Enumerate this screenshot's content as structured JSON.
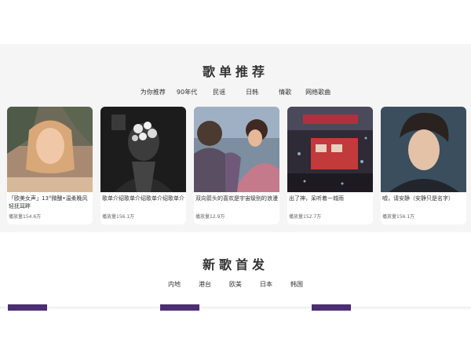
{
  "recommend": {
    "title": "歌单推荐",
    "tabs": [
      "为你推荐",
      "90年代",
      "民谣",
      "日韩",
      "情歌",
      "网络歌曲"
    ],
    "playlists": [
      {
        "title": "「欧美女声」13°微醺•温柔晚风轻抚耳畔",
        "plays": "播放量154.6万"
      },
      {
        "title": "歌单介绍歌单介绍歌单介绍歌单介",
        "plays": "播放量156.1万"
      },
      {
        "title": "双向箭头的喜欢是宇宙级别的浪漫",
        "plays": "播放量12.9万"
      },
      {
        "title": "出了神，呆听着一城雨",
        "plays": "播放量152.7万"
      },
      {
        "title": "嘘，请安静（安静只是名字）",
        "plays": "播放量156.1万"
      }
    ]
  },
  "new_songs": {
    "title": "新歌首发",
    "tabs": [
      "内地",
      "港台",
      "欧美",
      "日本",
      "韩国"
    ]
  },
  "colors": {
    "section_bg": "#f5f5f5",
    "text": "#333333",
    "muted": "#666666",
    "thumb": "#4c2e73"
  }
}
